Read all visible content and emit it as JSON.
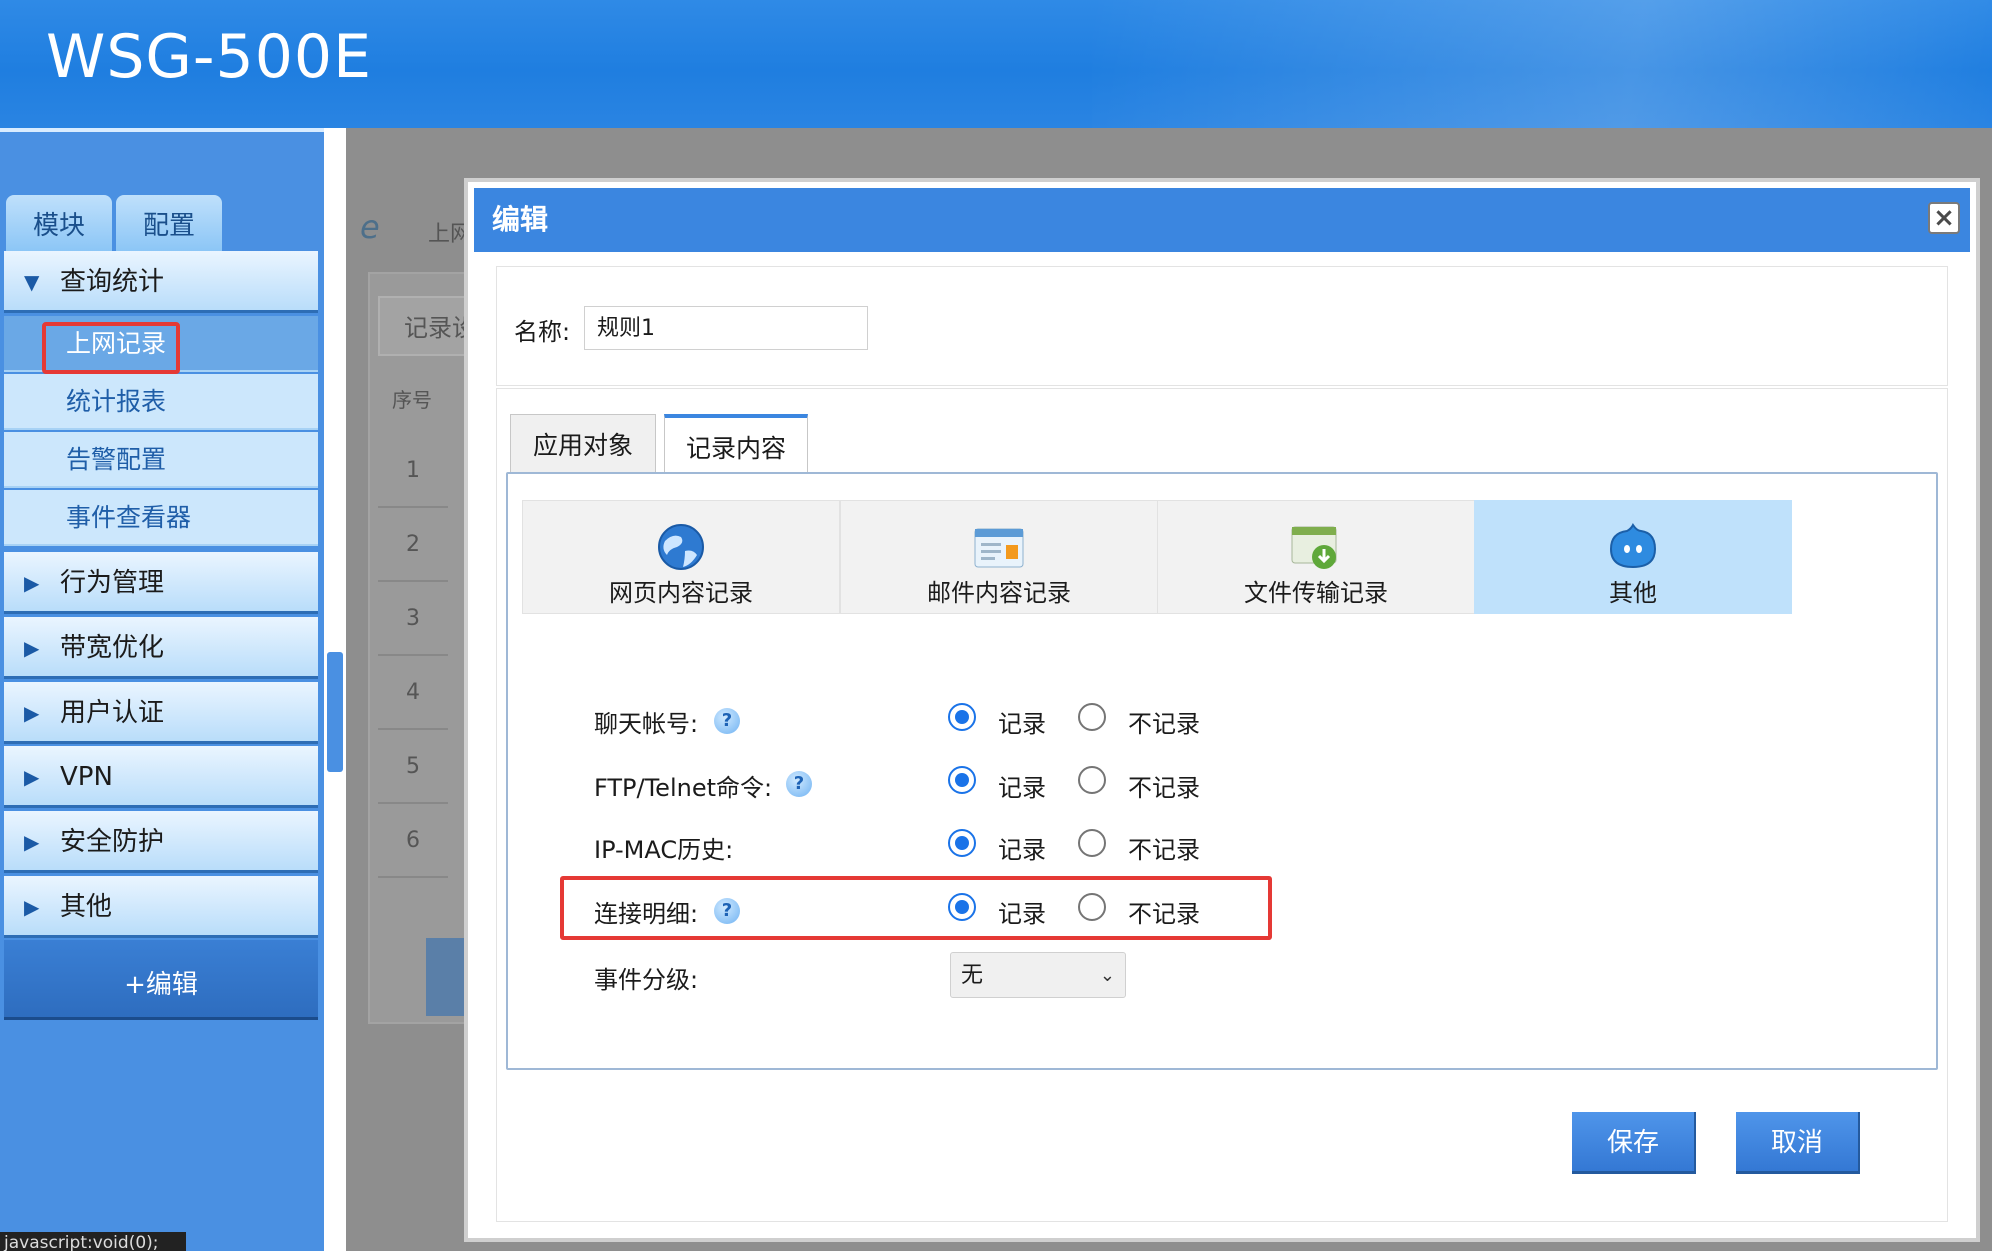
{
  "header": {
    "logo": "WSG-500E"
  },
  "sidebar": {
    "tabs": [
      {
        "label": "模块"
      },
      {
        "label": "配置"
      }
    ],
    "categories": [
      {
        "label": "查询统计",
        "expanded": true
      },
      {
        "label": "行为管理"
      },
      {
        "label": "带宽优化"
      },
      {
        "label": "用户认证"
      },
      {
        "label": "VPN"
      },
      {
        "label": "安全防护"
      },
      {
        "label": "其他"
      }
    ],
    "query_subitems": [
      {
        "label": "上网记录",
        "active": true
      },
      {
        "label": "统计报表"
      },
      {
        "label": "告警配置"
      },
      {
        "label": "事件查看器"
      }
    ],
    "edit_button": "+编辑",
    "status_bar": "javascript:void(0);"
  },
  "background": {
    "breadcrumb": "上网",
    "tab": "记录设",
    "seq_header": "序号",
    "rows": [
      "1",
      "2",
      "3",
      "4",
      "5",
      "6"
    ]
  },
  "modal": {
    "title": "编辑",
    "close_icon": "close-icon",
    "name_label": "名称:",
    "name_value": "规则1",
    "tabs": [
      {
        "label": "应用对象"
      },
      {
        "label": "记录内容",
        "active": true
      }
    ],
    "categories": [
      {
        "label": "网页内容记录",
        "icon": "globe-icon"
      },
      {
        "label": "邮件内容记录",
        "icon": "mail-icon"
      },
      {
        "label": "文件传输记录",
        "icon": "file-transfer-icon"
      },
      {
        "label": "其他",
        "icon": "other-chat-icon",
        "selected": true
      }
    ],
    "options": [
      {
        "label": "聊天帐号:",
        "help": true,
        "value": "记录"
      },
      {
        "label": "FTP/Telnet命令:",
        "help": true,
        "value": "记录"
      },
      {
        "label": "IP-MAC历史:",
        "help": false,
        "value": "记录"
      },
      {
        "label": "连接明细:",
        "help": true,
        "value": "记录",
        "highlighted": true
      }
    ],
    "record_label": "记录",
    "no_record_label": "不记录",
    "help_glyph": "?",
    "event_level_label": "事件分级:",
    "event_level_value": "无",
    "save_button": "保存",
    "cancel_button": "取消"
  },
  "colors": {
    "header_blue": "#2f8ae6",
    "sidebar_blue": "#4a90e2",
    "modal_title_blue": "#3b86e0",
    "radio_blue": "#1a73e8",
    "highlight_red": "#e53935",
    "selected_tile": "#bfe1fb"
  }
}
